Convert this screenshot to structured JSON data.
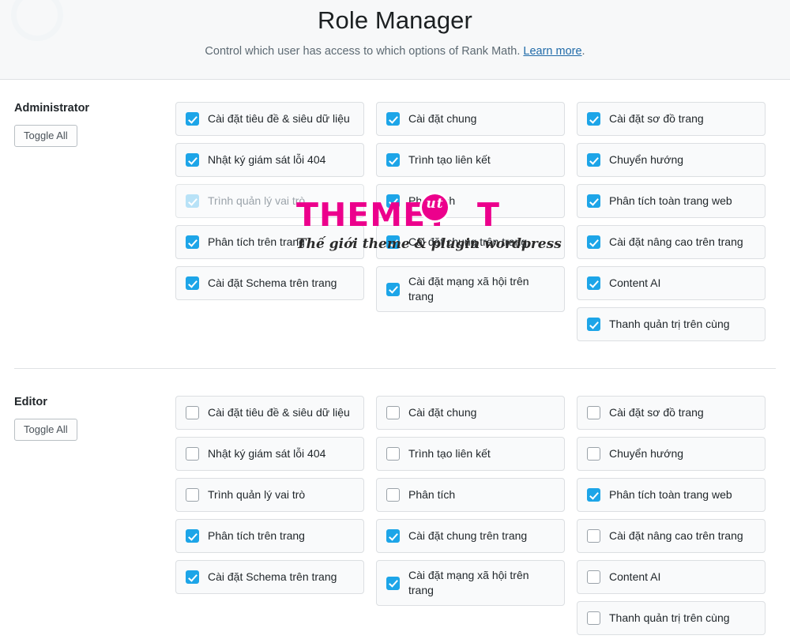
{
  "header": {
    "title": "Role Manager",
    "subtitle_before": "Control which user has access to which options of Rank Math.",
    "link_label": "Learn more",
    "subtitle_after": "."
  },
  "toggle_all_label": "Toggle All",
  "colors": {
    "accent": "#1da5e8",
    "accent_disabled": "#b8e2f7",
    "link": "#1f6aa8",
    "header_bg": "#f7f8f9",
    "card_bg": "#f9fafb",
    "card_border": "#dcdfe2",
    "watermark": "#ec008c"
  },
  "watermark": {
    "word1": "THEME",
    "word2": "T",
    "word3": "T",
    "dot_letter": "ut",
    "tagline": "Thế giới theme & plugin wordpress"
  },
  "roles": [
    {
      "name": "Administrator",
      "toggle_all": "Toggle All",
      "columns": [
        [
          {
            "label": "Cài đặt tiêu đề & siêu dữ liệu",
            "checked": true,
            "disabled": false,
            "two_line": false
          },
          {
            "label": "Nhật ký giám sát lỗi 404",
            "checked": true,
            "disabled": false,
            "two_line": false
          },
          {
            "label": "Trình quản lý vai trò",
            "checked": true,
            "disabled": true,
            "two_line": false
          },
          {
            "label": "Phân tích trên trang",
            "checked": true,
            "disabled": false,
            "two_line": false
          },
          {
            "label": "Cài đặt Schema trên trang",
            "checked": true,
            "disabled": false,
            "two_line": false
          }
        ],
        [
          {
            "label": "Cài đặt chung",
            "checked": true,
            "disabled": false,
            "two_line": false
          },
          {
            "label": "Trình tạo liên kết",
            "checked": true,
            "disabled": false,
            "two_line": false
          },
          {
            "label": "Phân tích",
            "checked": true,
            "disabled": false,
            "two_line": false
          },
          {
            "label": "Cài đặt chung trên trang",
            "checked": true,
            "disabled": false,
            "two_line": false
          },
          {
            "label": "Cài đặt mạng xã hội trên trang",
            "checked": true,
            "disabled": false,
            "two_line": true
          }
        ],
        [
          {
            "label": "Cài đặt sơ đồ trang",
            "checked": true,
            "disabled": false,
            "two_line": false
          },
          {
            "label": "Chuyển hướng",
            "checked": true,
            "disabled": false,
            "two_line": false
          },
          {
            "label": "Phân tích toàn trang web",
            "checked": true,
            "disabled": false,
            "two_line": false
          },
          {
            "label": "Cài đặt nâng cao trên trang",
            "checked": true,
            "disabled": false,
            "two_line": false
          },
          {
            "label": "Content AI",
            "checked": true,
            "disabled": false,
            "two_line": false
          },
          {
            "label": "Thanh quản trị trên cùng",
            "checked": true,
            "disabled": false,
            "two_line": false
          }
        ]
      ]
    },
    {
      "name": "Editor",
      "toggle_all": "Toggle All",
      "columns": [
        [
          {
            "label": "Cài đặt tiêu đề & siêu dữ liệu",
            "checked": false,
            "disabled": false,
            "two_line": false
          },
          {
            "label": "Nhật ký giám sát lỗi 404",
            "checked": false,
            "disabled": false,
            "two_line": false
          },
          {
            "label": "Trình quản lý vai trò",
            "checked": false,
            "disabled": false,
            "two_line": false
          },
          {
            "label": "Phân tích trên trang",
            "checked": true,
            "disabled": false,
            "two_line": false
          },
          {
            "label": "Cài đặt Schema trên trang",
            "checked": true,
            "disabled": false,
            "two_line": false
          }
        ],
        [
          {
            "label": "Cài đặt chung",
            "checked": false,
            "disabled": false,
            "two_line": false
          },
          {
            "label": "Trình tạo liên kết",
            "checked": false,
            "disabled": false,
            "two_line": false
          },
          {
            "label": "Phân tích",
            "checked": false,
            "disabled": false,
            "two_line": false
          },
          {
            "label": "Cài đặt chung trên trang",
            "checked": true,
            "disabled": false,
            "two_line": false
          },
          {
            "label": "Cài đặt mạng xã hội trên trang",
            "checked": true,
            "disabled": false,
            "two_line": true
          }
        ],
        [
          {
            "label": "Cài đặt sơ đồ trang",
            "checked": false,
            "disabled": false,
            "two_line": false
          },
          {
            "label": "Chuyển hướng",
            "checked": false,
            "disabled": false,
            "two_line": false
          },
          {
            "label": "Phân tích toàn trang web",
            "checked": true,
            "disabled": false,
            "two_line": false
          },
          {
            "label": "Cài đặt nâng cao trên trang",
            "checked": false,
            "disabled": false,
            "two_line": false
          },
          {
            "label": "Content AI",
            "checked": false,
            "disabled": false,
            "two_line": false
          },
          {
            "label": "Thanh quản trị trên cùng",
            "checked": false,
            "disabled": false,
            "two_line": false
          }
        ]
      ]
    }
  ]
}
